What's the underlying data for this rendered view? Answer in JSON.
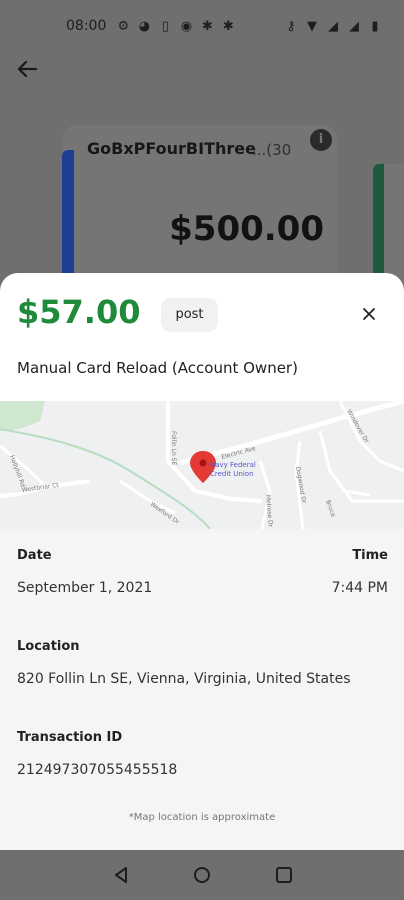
{
  "status_bar": {
    "time": "08:00",
    "left_icons": [
      "gear-icon",
      "notification-icon",
      "sim-icon",
      "app-icon",
      "android-icon",
      "android-icon"
    ],
    "right_icons": [
      "key-icon",
      "wifi-icon",
      "signal-icon",
      "signal-icon",
      "battery-icon"
    ]
  },
  "background": {
    "card_name": "GoBxPFourBIThree",
    "card_suffix": "...(30",
    "card_balance": "$500.00",
    "card_accent": "#1e3f8f",
    "card2_accent": "#1e5a3d"
  },
  "sheet": {
    "amount": "$57.00",
    "amount_color": "#1e8a3a",
    "status": "post",
    "description": "Manual Card Reload (Account Owner)",
    "map": {
      "place_name_line1": "Navy Federal",
      "place_name_line2": "Credit Union",
      "streets": [
        "Follin Ln SE",
        "Electric Ave",
        "Windover Dr",
        "Westbriar Ct",
        "Dogwood Dr",
        "Melrose Dr",
        "Bruce",
        "Hollyhill Rd",
        "Wexford Dr"
      ]
    },
    "date_label": "Date",
    "date_value": "September 1, 2021",
    "time_label": "Time",
    "time_value": "7:44 PM",
    "location_label": "Location",
    "location_value": "820 Follin Ln SE, Vienna, Virginia, United States",
    "transaction_label": "Transaction ID",
    "transaction_value": "212497307055455518",
    "footnote": "*Map location is approximate"
  }
}
